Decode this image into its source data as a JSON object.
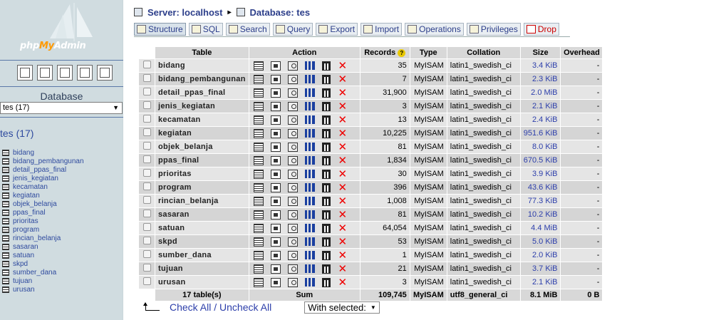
{
  "sidebar": {
    "logo_text_php": "php",
    "logo_text_my": "My",
    "logo_text_admin": "Admin",
    "quick_icons": [
      "home-icon",
      "query-window-icon",
      "sql-doc-icon",
      "docs-icon",
      "changelog-icon"
    ],
    "database_label": "Database",
    "database_select_value": "tes (17)",
    "database_heading": "tes (17)",
    "tables": [
      "bidang",
      "bidang_pembangunan",
      "detail_ppas_final",
      "jenis_kegiatan",
      "kecamatan",
      "kegiatan",
      "objek_belanja",
      "ppas_final",
      "prioritas",
      "program",
      "rincian_belanja",
      "sasaran",
      "satuan",
      "skpd",
      "sumber_dana",
      "tujuan",
      "urusan"
    ]
  },
  "breadcrumb": {
    "server": "Server: localhost",
    "separator": "▸",
    "database": "Database: tes"
  },
  "tabs": [
    {
      "label": "Structure",
      "icon": "structure-icon",
      "active": true
    },
    {
      "label": "SQL",
      "icon": "sql-icon"
    },
    {
      "label": "Search",
      "icon": "search-icon"
    },
    {
      "label": "Query",
      "icon": "query-icon"
    },
    {
      "label": "Export",
      "icon": "export-icon"
    },
    {
      "label": "Import",
      "icon": "import-icon"
    },
    {
      "label": "Operations",
      "icon": "operations-icon"
    },
    {
      "label": "Privileges",
      "icon": "privileges-icon"
    },
    {
      "label": "Drop",
      "icon": "drop-icon"
    }
  ],
  "table": {
    "headers": {
      "table": "Table",
      "action": "Action",
      "records": "Records",
      "type": "Type",
      "collation": "Collation",
      "size": "Size",
      "overhead": "Overhead"
    },
    "rows": [
      {
        "name": "bidang",
        "records": "35",
        "type": "MyISAM",
        "collation": "latin1_swedish_ci",
        "size": "3.4 KiB",
        "overhead": "-"
      },
      {
        "name": "bidang_pembangunan",
        "records": "7",
        "type": "MyISAM",
        "collation": "latin1_swedish_ci",
        "size": "2.3 KiB",
        "overhead": "-"
      },
      {
        "name": "detail_ppas_final",
        "records": "31,900",
        "type": "MyISAM",
        "collation": "latin1_swedish_ci",
        "size": "2.0 MiB",
        "overhead": "-"
      },
      {
        "name": "jenis_kegiatan",
        "records": "3",
        "type": "MyISAM",
        "collation": "latin1_swedish_ci",
        "size": "2.1 KiB",
        "overhead": "-"
      },
      {
        "name": "kecamatan",
        "records": "13",
        "type": "MyISAM",
        "collation": "latin1_swedish_ci",
        "size": "2.4 KiB",
        "overhead": "-"
      },
      {
        "name": "kegiatan",
        "records": "10,225",
        "type": "MyISAM",
        "collation": "latin1_swedish_ci",
        "size": "951.6 KiB",
        "overhead": "-"
      },
      {
        "name": "objek_belanja",
        "records": "81",
        "type": "MyISAM",
        "collation": "latin1_swedish_ci",
        "size": "8.0 KiB",
        "overhead": "-"
      },
      {
        "name": "ppas_final",
        "records": "1,834",
        "type": "MyISAM",
        "collation": "latin1_swedish_ci",
        "size": "670.5 KiB",
        "overhead": "-"
      },
      {
        "name": "prioritas",
        "records": "30",
        "type": "MyISAM",
        "collation": "latin1_swedish_ci",
        "size": "3.9 KiB",
        "overhead": "-"
      },
      {
        "name": "program",
        "records": "396",
        "type": "MyISAM",
        "collation": "latin1_swedish_ci",
        "size": "43.6 KiB",
        "overhead": "-"
      },
      {
        "name": "rincian_belanja",
        "records": "1,008",
        "type": "MyISAM",
        "collation": "latin1_swedish_ci",
        "size": "77.3 KiB",
        "overhead": "-"
      },
      {
        "name": "sasaran",
        "records": "81",
        "type": "MyISAM",
        "collation": "latin1_swedish_ci",
        "size": "10.2 KiB",
        "overhead": "-"
      },
      {
        "name": "satuan",
        "records": "64,054",
        "type": "MyISAM",
        "collation": "latin1_swedish_ci",
        "size": "4.4 MiB",
        "overhead": "-"
      },
      {
        "name": "skpd",
        "records": "53",
        "type": "MyISAM",
        "collation": "latin1_swedish_ci",
        "size": "5.0 KiB",
        "overhead": "-"
      },
      {
        "name": "sumber_dana",
        "records": "1",
        "type": "MyISAM",
        "collation": "latin1_swedish_ci",
        "size": "2.0 KiB",
        "overhead": "-"
      },
      {
        "name": "tujuan",
        "records": "21",
        "type": "MyISAM",
        "collation": "latin1_swedish_ci",
        "size": "3.7 KiB",
        "overhead": "-"
      },
      {
        "name": "urusan",
        "records": "3",
        "type": "MyISAM",
        "collation": "latin1_swedish_ci",
        "size": "2.1 KiB",
        "overhead": "-"
      }
    ],
    "action_icons": [
      "browse-icon",
      "structure-icon",
      "search-icon",
      "insert-icon",
      "empty-icon",
      "drop-icon"
    ],
    "summary": {
      "tables": "17 table(s)",
      "label": "Sum",
      "records": "109,745",
      "type": "MyISAM",
      "collation": "utf8_general_ci",
      "size": "8.1 MiB",
      "overhead": "0 B"
    }
  },
  "footer": {
    "check_all": "Check All",
    "slash": " / ",
    "uncheck_all": "Uncheck All",
    "with_selected": "With selected:"
  },
  "colors": {
    "accent": "#2c3eaa",
    "sidebar_bg": "#d0dce0",
    "drop_red": "#e00000"
  }
}
